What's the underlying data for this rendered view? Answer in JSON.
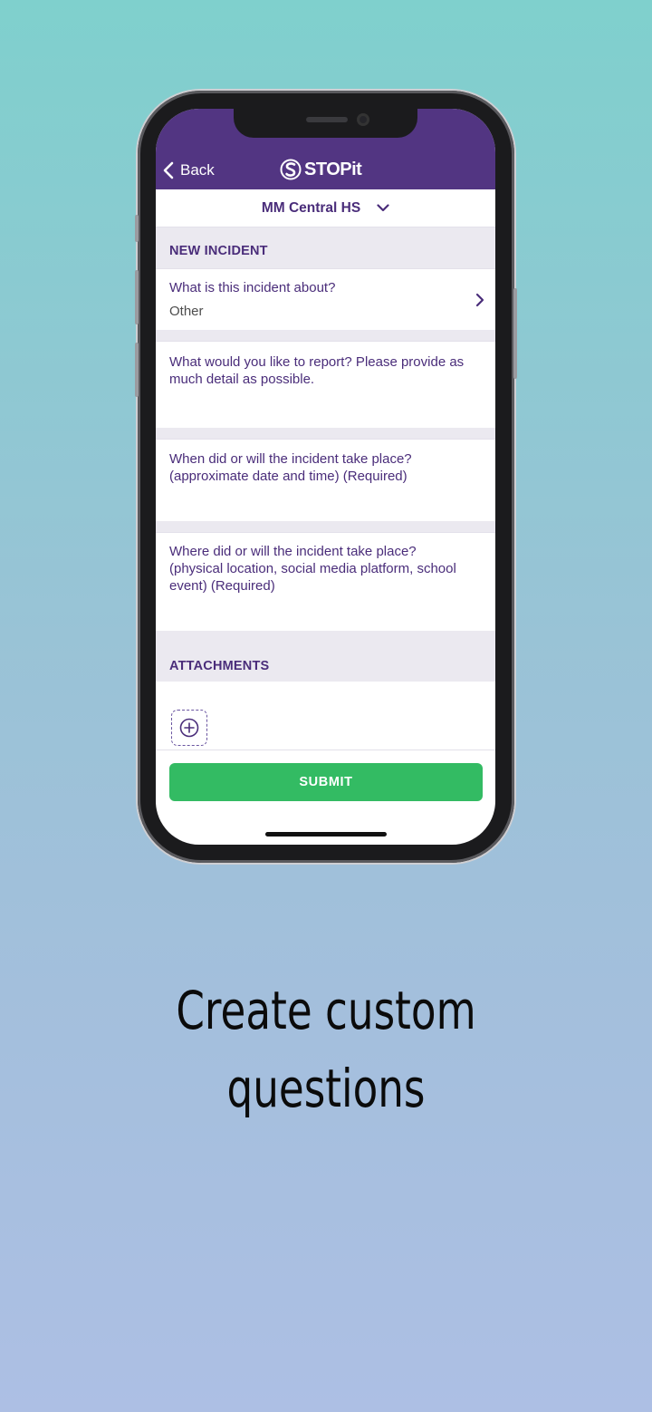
{
  "nav": {
    "back_label": "Back",
    "logo_text": "STOPit"
  },
  "school": {
    "name": "MM Central HS"
  },
  "form": {
    "section_title": "NEW INCIDENT",
    "about_question": "What is this incident about?",
    "about_answer": "Other",
    "report_question": "What would you like to report? Please provide as much detail as possible.",
    "when_question": "When did or will the incident take place? (approximate date and time) (Required)",
    "where_question": "Where did or will the incident take place? (physical location, social media platform, school event) (Required)"
  },
  "attachments": {
    "section_title": "ATTACHMENTS"
  },
  "submit_label": "SUBMIT",
  "caption": {
    "line1": "Create custom",
    "line2": "questions"
  },
  "colors": {
    "brand_purple": "#523582",
    "submit_green": "#33bb63"
  },
  "icons": [
    "back-chevron-icon",
    "stopit-logo-icon",
    "chevron-down-icon",
    "chevron-right-icon",
    "plus-circle-icon"
  ]
}
